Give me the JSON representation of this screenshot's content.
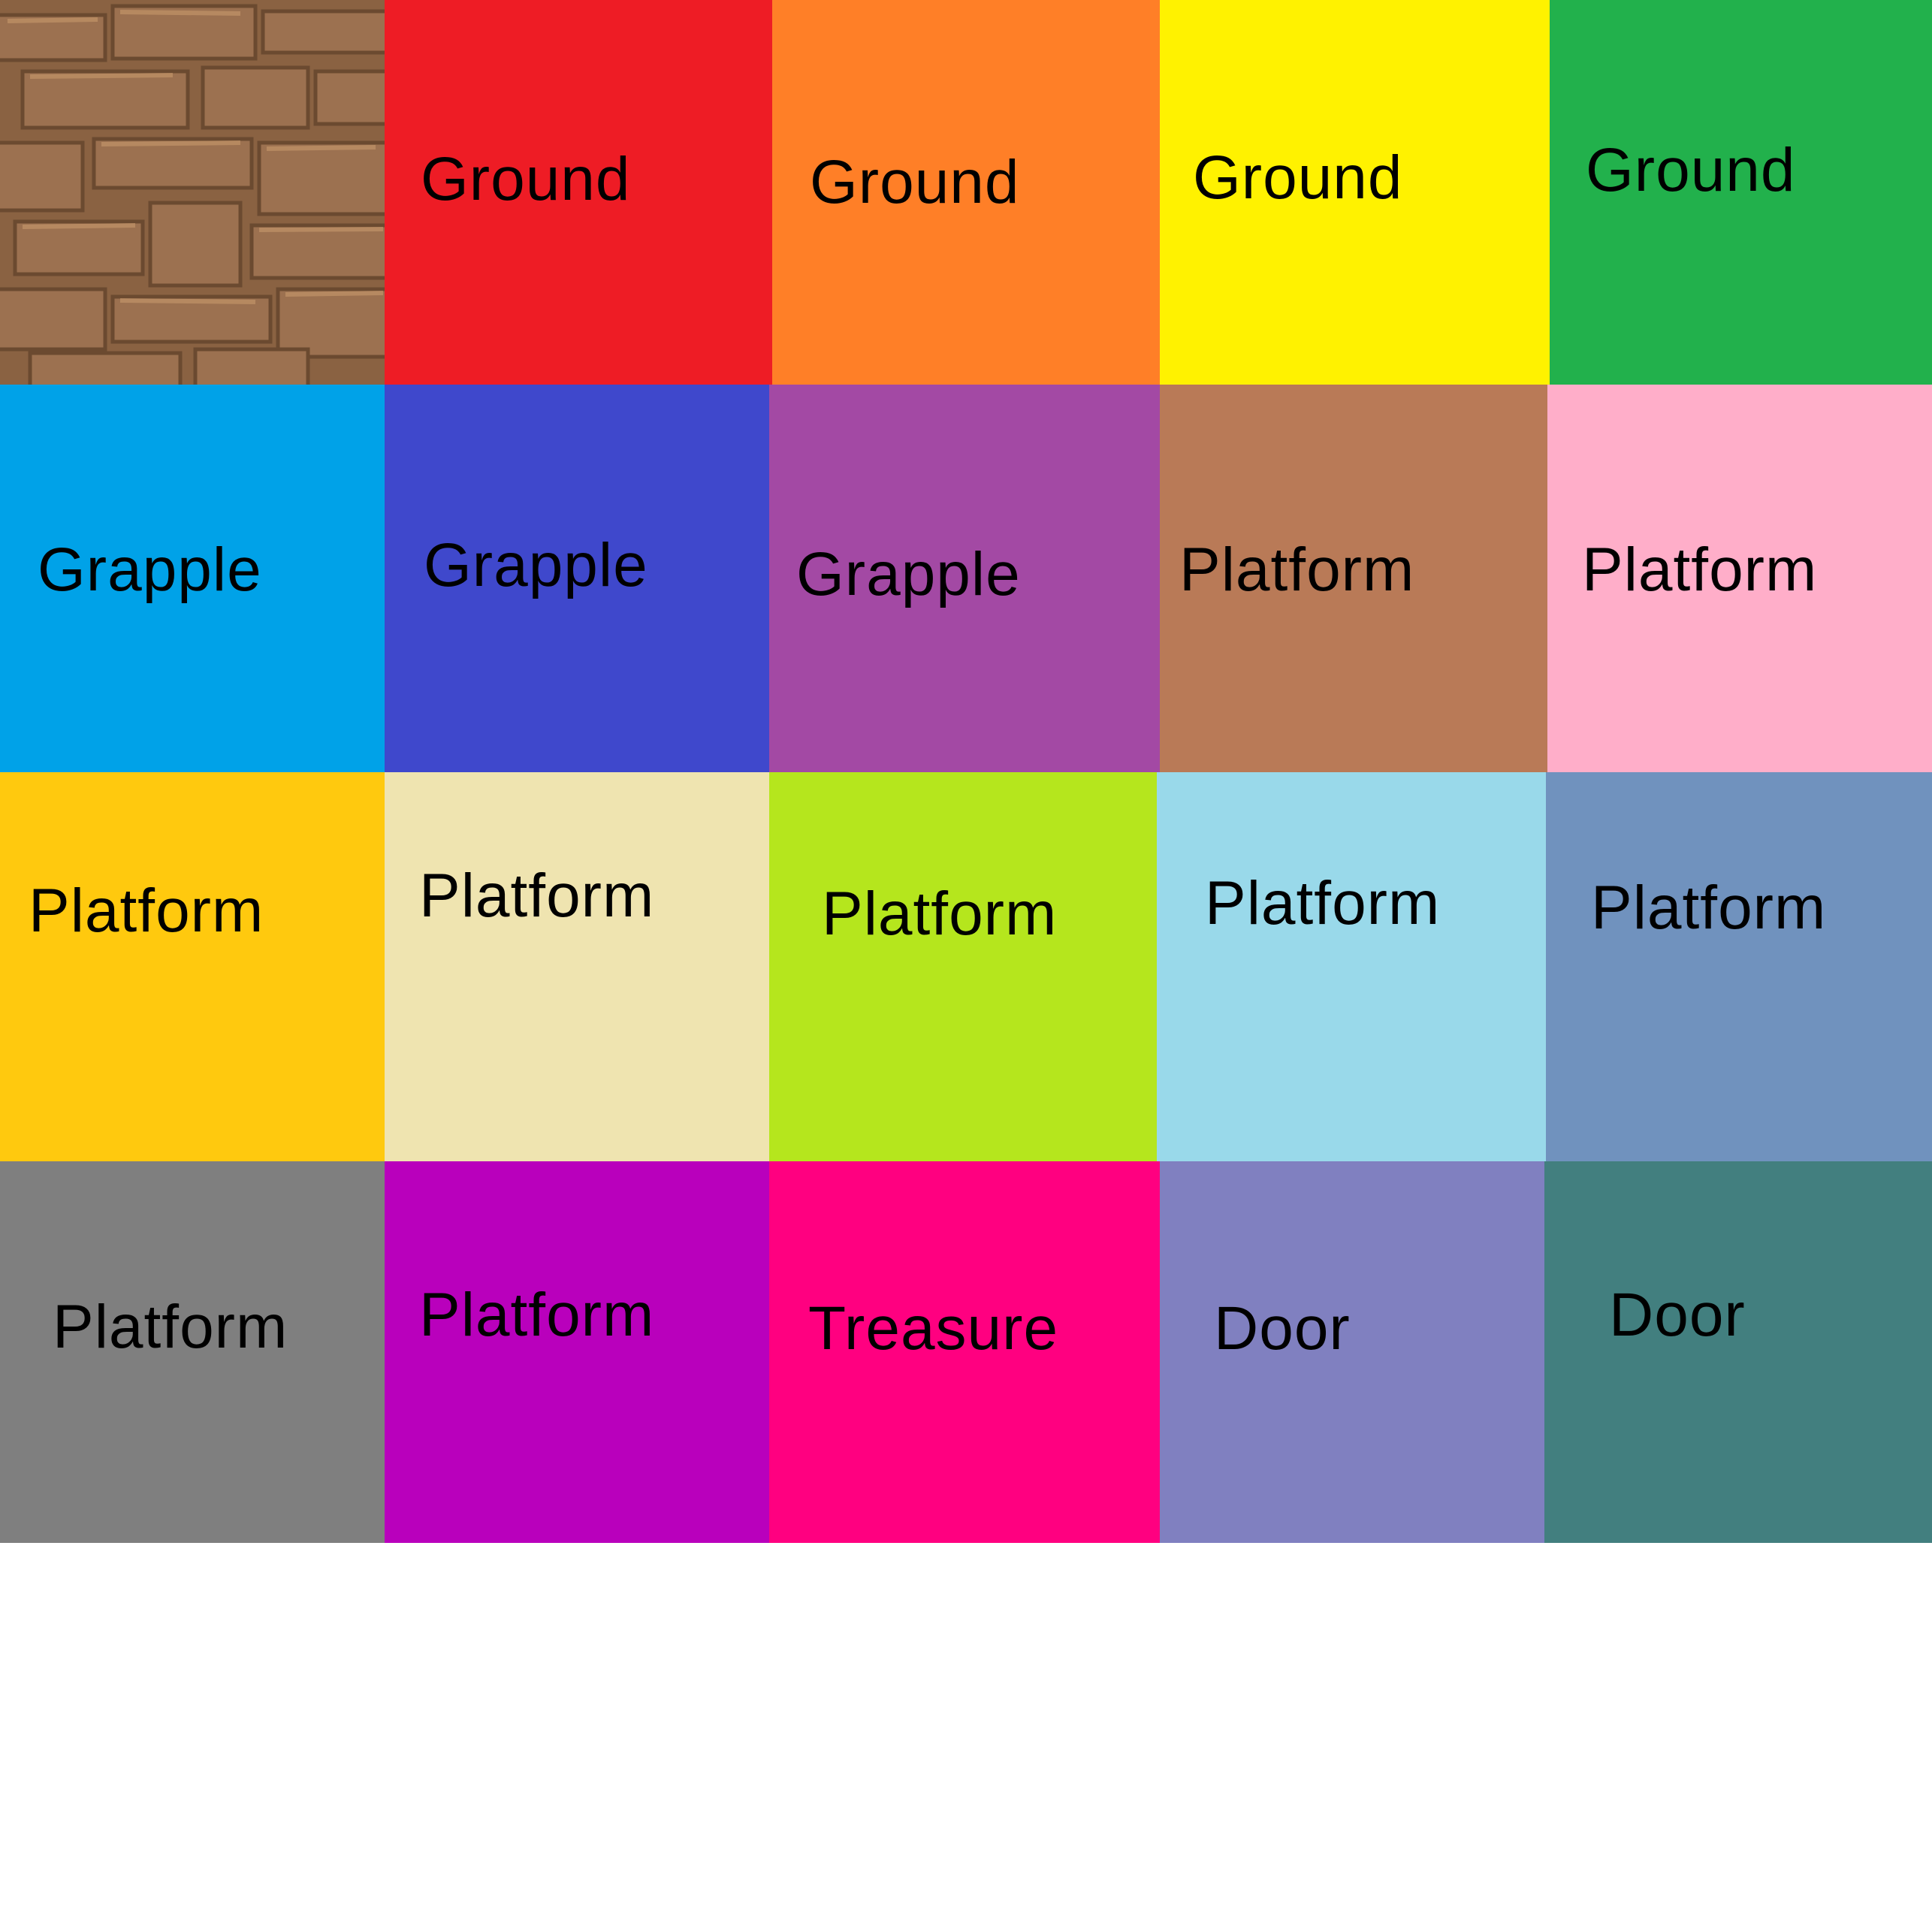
{
  "tiles": [
    {
      "label": "",
      "color": "#8a6242",
      "texture": "rock-texture"
    },
    {
      "label": "Ground",
      "color": "#ee1c25"
    },
    {
      "label": "Ground",
      "color": "#ff7f27"
    },
    {
      "label": "Ground",
      "color": "#fff200"
    },
    {
      "label": "Ground",
      "color": "#22b14c"
    },
    {
      "label": "Grapple",
      "color": "#00a2e8"
    },
    {
      "label": "Grapple",
      "color": "#3f48cc"
    },
    {
      "label": "Grapple",
      "color": "#a349a4"
    },
    {
      "label": "Platform",
      "color": "#b97a57"
    },
    {
      "label": "Platform",
      "color": "#ffaec9"
    },
    {
      "label": "Platform",
      "color": "#ffc90e"
    },
    {
      "label": "Platform",
      "color": "#efe4b0"
    },
    {
      "label": "Platform",
      "color": "#b5e61d"
    },
    {
      "label": "Platform",
      "color": "#99d9ea"
    },
    {
      "label": "Platform",
      "color": "#7092be"
    },
    {
      "label": "Platform",
      "color": "#7f7f7f"
    },
    {
      "label": "Platform",
      "color": "#b900bc"
    },
    {
      "label": "Treasure",
      "color": "#ff0080"
    },
    {
      "label": "Door",
      "color": "#8080c0"
    },
    {
      "label": "Door",
      "color": "#427f7f"
    }
  ]
}
